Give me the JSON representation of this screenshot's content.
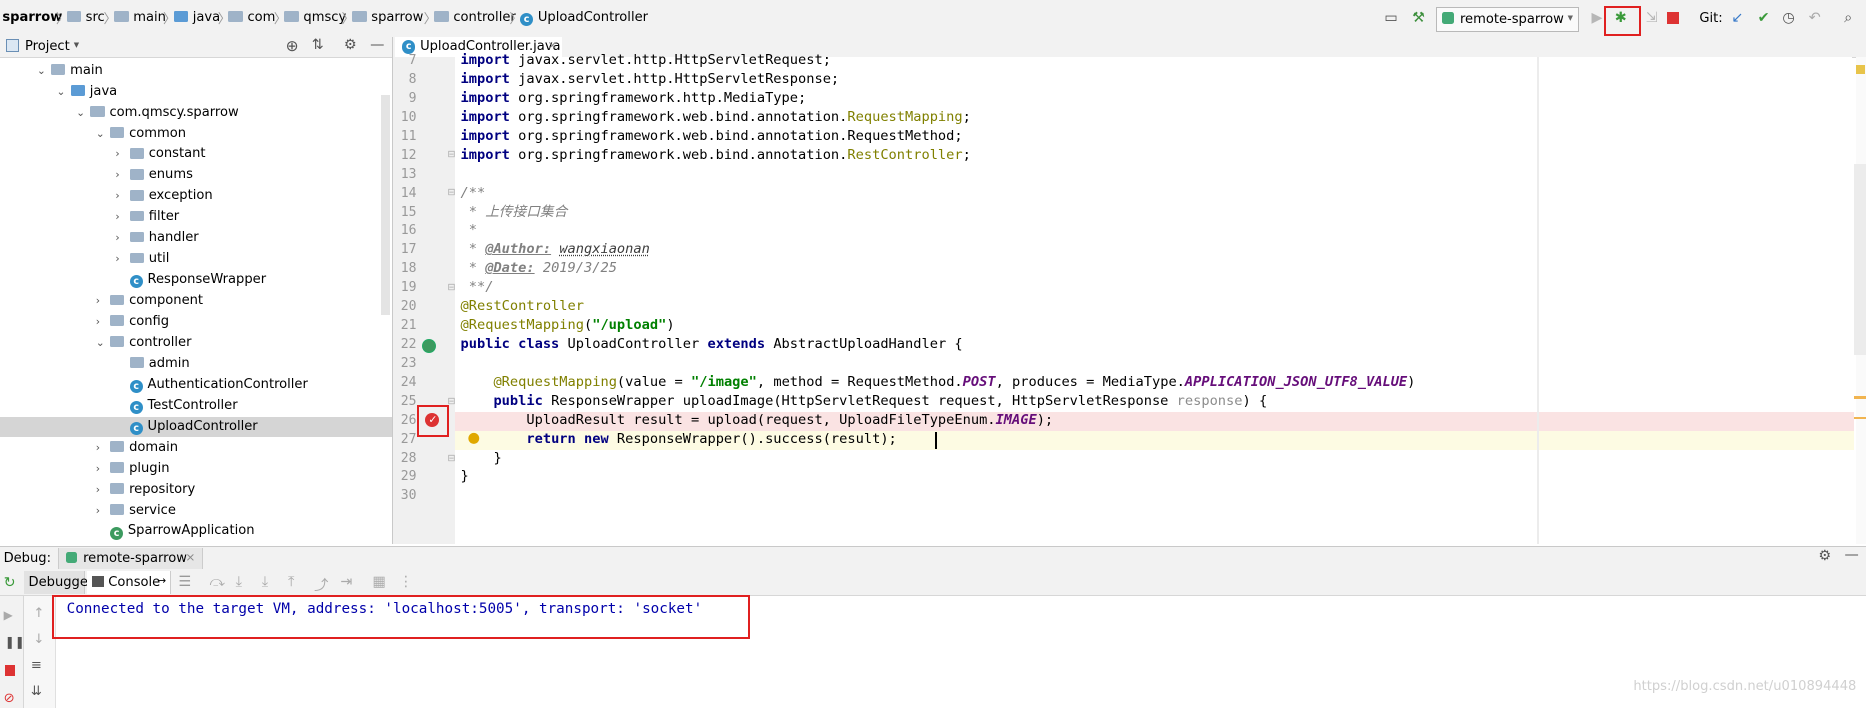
{
  "breadcrumbs": [
    "sparrow",
    "src",
    "main",
    "java",
    "com",
    "qmscy",
    "sparrow",
    "controller",
    "UploadController"
  ],
  "toolbar": {
    "run_config": "remote-sparrow",
    "git_label": "Git:"
  },
  "project_panel": {
    "title": "Project",
    "tree": [
      {
        "label": "main",
        "depth": 2,
        "kind": "folder",
        "expanded": true
      },
      {
        "label": "java",
        "depth": 3,
        "kind": "folder",
        "expanded": true
      },
      {
        "label": "com.qmscy.sparrow",
        "depth": 4,
        "kind": "package",
        "expanded": true
      },
      {
        "label": "common",
        "depth": 5,
        "kind": "package",
        "expanded": true
      },
      {
        "label": "constant",
        "depth": 6,
        "kind": "package",
        "expanded": false
      },
      {
        "label": "enums",
        "depth": 6,
        "kind": "package",
        "expanded": false
      },
      {
        "label": "exception",
        "depth": 6,
        "kind": "package",
        "expanded": false
      },
      {
        "label": "filter",
        "depth": 6,
        "kind": "package",
        "expanded": false
      },
      {
        "label": "handler",
        "depth": 6,
        "kind": "package",
        "expanded": false
      },
      {
        "label": "util",
        "depth": 6,
        "kind": "package",
        "expanded": false
      },
      {
        "label": "ResponseWrapper",
        "depth": 6,
        "kind": "class"
      },
      {
        "label": "component",
        "depth": 5,
        "kind": "package",
        "expanded": false
      },
      {
        "label": "config",
        "depth": 5,
        "kind": "package",
        "expanded": false
      },
      {
        "label": "controller",
        "depth": 5,
        "kind": "package",
        "expanded": true
      },
      {
        "label": "admin",
        "depth": 6,
        "kind": "package"
      },
      {
        "label": "AuthenticationController",
        "depth": 6,
        "kind": "class"
      },
      {
        "label": "TestController",
        "depth": 6,
        "kind": "class"
      },
      {
        "label": "UploadController",
        "depth": 6,
        "kind": "class",
        "selected": true
      },
      {
        "label": "domain",
        "depth": 5,
        "kind": "package",
        "expanded": false
      },
      {
        "label": "plugin",
        "depth": 5,
        "kind": "package",
        "expanded": false
      },
      {
        "label": "repository",
        "depth": 5,
        "kind": "package",
        "expanded": false
      },
      {
        "label": "service",
        "depth": 5,
        "kind": "package",
        "expanded": false
      },
      {
        "label": "SparrowApplication",
        "depth": 5,
        "kind": "springclass"
      }
    ]
  },
  "editor": {
    "tab_label": "UploadController.java",
    "lines": [
      {
        "n": "7",
        "html": "<span class='kw'>import</span> javax.servlet.http.HttpServletRequest;"
      },
      {
        "n": "8",
        "html": "<span class='kw'>import</span> javax.servlet.http.HttpServletResponse;"
      },
      {
        "n": "9",
        "html": "<span class='kw'>import</span> org.springframework.http.MediaType;"
      },
      {
        "n": "10",
        "html": "<span class='kw'>import</span> org.springframework.web.bind.annotation.<span class='ann'>RequestMapping</span>;"
      },
      {
        "n": "11",
        "html": "<span class='kw'>import</span> org.springframework.web.bind.annotation.RequestMethod;"
      },
      {
        "n": "12",
        "html": "<span class='kw'>import</span> org.springframework.web.bind.annotation.<span class='ann'>RestController</span>;"
      },
      {
        "n": "13",
        "html": ""
      },
      {
        "n": "14",
        "html": "<span class='cmt'>/**</span>"
      },
      {
        "n": "15",
        "html": "<span class='cmt'> * 上传接口集合</span>"
      },
      {
        "n": "16",
        "html": "<span class='cmt'> *</span>"
      },
      {
        "n": "17",
        "html": "<span class='cmt'> * </span><span class='cmt-tag'>@Author:</span><span class='cmt'> </span><span class='cmt-val' style='text-decoration:underline dotted'>wangxiaonan</span>"
      },
      {
        "n": "18",
        "html": "<span class='cmt'> * </span><span class='cmt-tag'>@Date:</span><span class='cmt'> 2019/3/25</span>"
      },
      {
        "n": "19",
        "html": "<span class='cmt'> **/</span>"
      },
      {
        "n": "20",
        "html": "<span class='ann'>@RestController</span>"
      },
      {
        "n": "21",
        "html": "<span class='ann'>@RequestMapping</span>(<span class='str'>\"/upload\"</span>)"
      },
      {
        "n": "22",
        "html": "<span class='kw'>public class</span> UploadController <span class='kw'>extends</span> AbstractUploadHandler {"
      },
      {
        "n": "23",
        "html": ""
      },
      {
        "n": "24",
        "html": "    <span class='ann'>@RequestMapping</span>(value = <span class='str'>\"/image\"</span>, method = RequestMethod.<span class='const'>POST</span>, produces = MediaType.<span class='const'>APPLICATION_JSON_UTF8_VALUE</span>)"
      },
      {
        "n": "25",
        "html": "    <span class='kw'>public</span> ResponseWrapper uploadImage(HttpServletRequest request, HttpServletResponse <span class='gray'>response</span>) {"
      },
      {
        "n": "26",
        "html": "        UploadResult result = upload(request, UploadFileTypeEnum.<span class='const'>IMAGE</span>);"
      },
      {
        "n": "27",
        "html": "        <span class='kw'>return new</span> ResponseWrapper().success(result);"
      },
      {
        "n": "28",
        "html": "    }"
      },
      {
        "n": "29",
        "html": "}"
      },
      {
        "n": "30",
        "html": ""
      }
    ]
  },
  "debug": {
    "label": "Debug:",
    "session_tab": "remote-sparrow",
    "tab_debugger": "Debugger",
    "tab_console": "Console",
    "console_output": "Connected to the target VM, address: 'localhost:5005', transport: 'socket'"
  },
  "watermark": "https://blog.csdn.net/u010894448",
  "colors": {
    "accent": "#4083c9",
    "highlight_box": "#e02020",
    "breakpoint": "#d33"
  }
}
